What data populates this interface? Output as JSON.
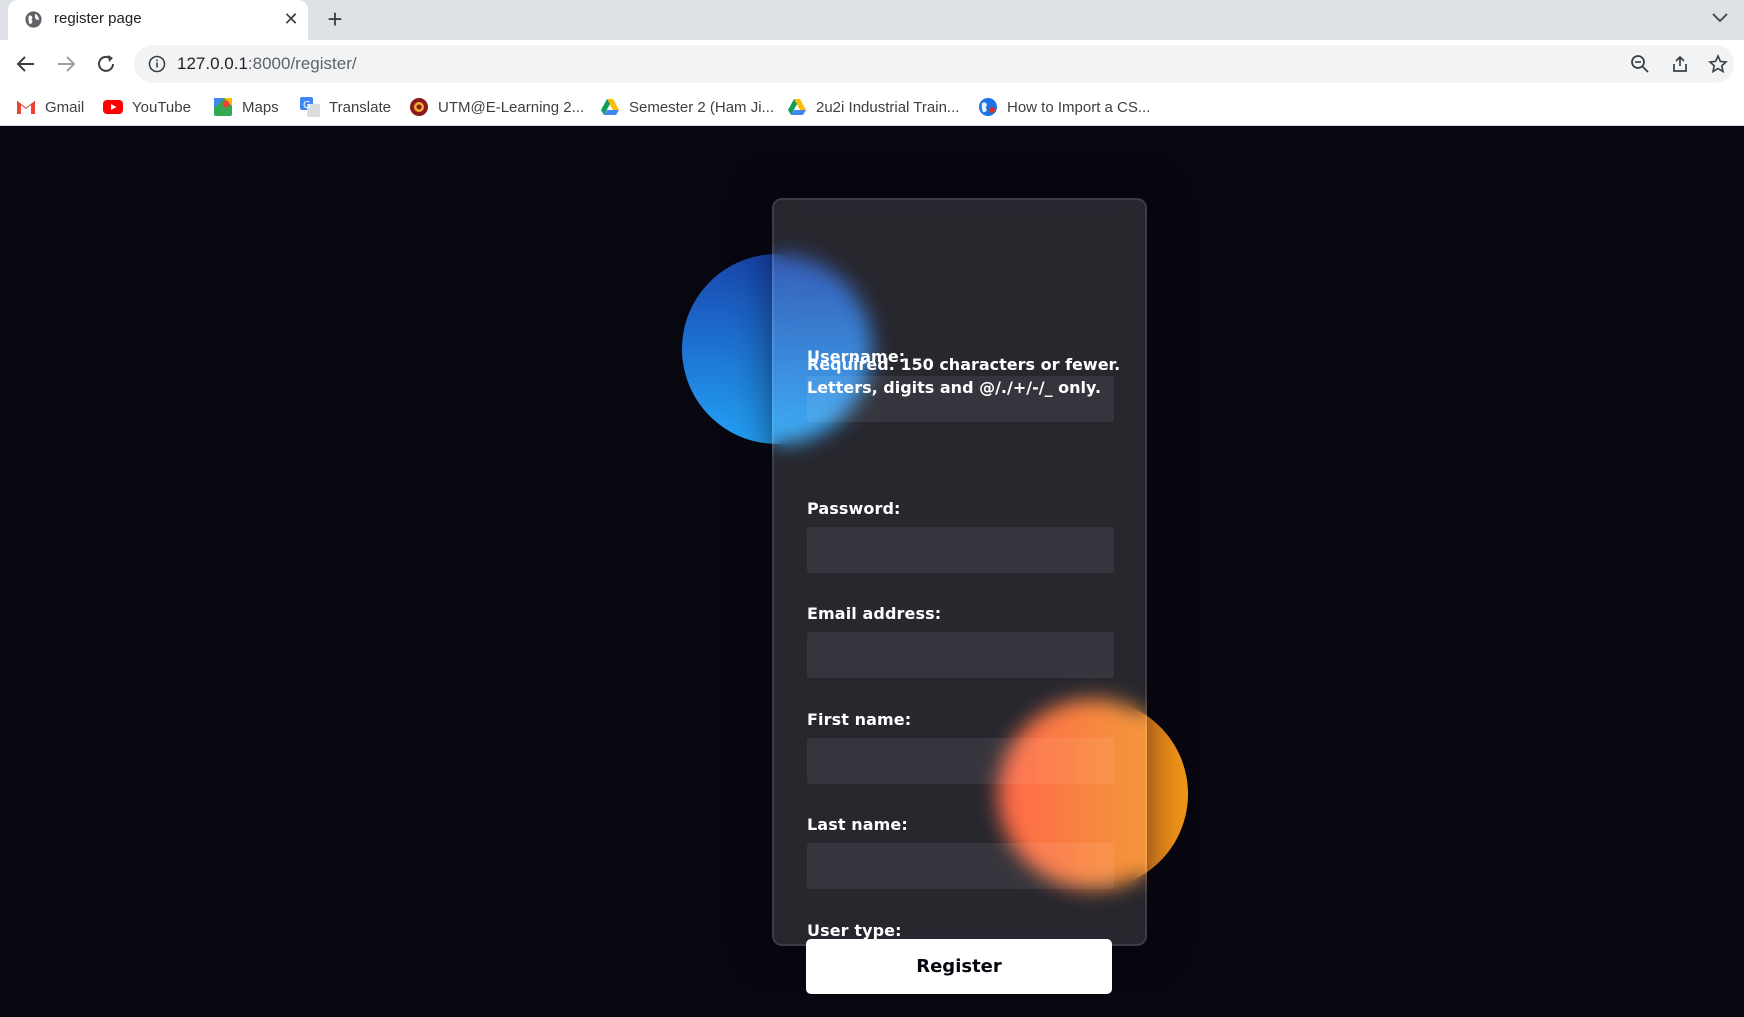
{
  "browser": {
    "tab_title": "register page",
    "url_host": "127.0.0.1",
    "url_path": ":8000/register/",
    "bookmarks": [
      {
        "label": "Gmail",
        "icon": "gmail-icon"
      },
      {
        "label": "YouTube",
        "icon": "youtube-icon"
      },
      {
        "label": "Maps",
        "icon": "maps-icon"
      },
      {
        "label": "Translate",
        "icon": "translate-icon"
      },
      {
        "label": "UTM@E-Learning 2...",
        "icon": "utm-icon"
      },
      {
        "label": "Semester 2 (Ham Ji...",
        "icon": "drive-icon"
      },
      {
        "label": "2u2i Industrial Train...",
        "icon": "drive-icon"
      },
      {
        "label": "How to Import a CS...",
        "icon": "globe-icon"
      }
    ]
  },
  "form": {
    "username_label": "Username:",
    "username_value": "",
    "username_help_line1": "Required. 150 characters or fewer.",
    "username_help_line2": "Letters, digits and @/./+/-/_ only.",
    "password_label": "Password:",
    "password_value": "",
    "email_label": "Email address:",
    "email_value": "",
    "first_name_label": "First name:",
    "first_name_value": "",
    "last_name_label": "Last name:",
    "last_name_value": "",
    "user_type_label": "User type:",
    "user_type_value": "",
    "submit_label": "Register"
  },
  "colors": {
    "page_background": "#080710",
    "blue_shape": "#23a2f6",
    "orange_shape": "#f09819"
  }
}
